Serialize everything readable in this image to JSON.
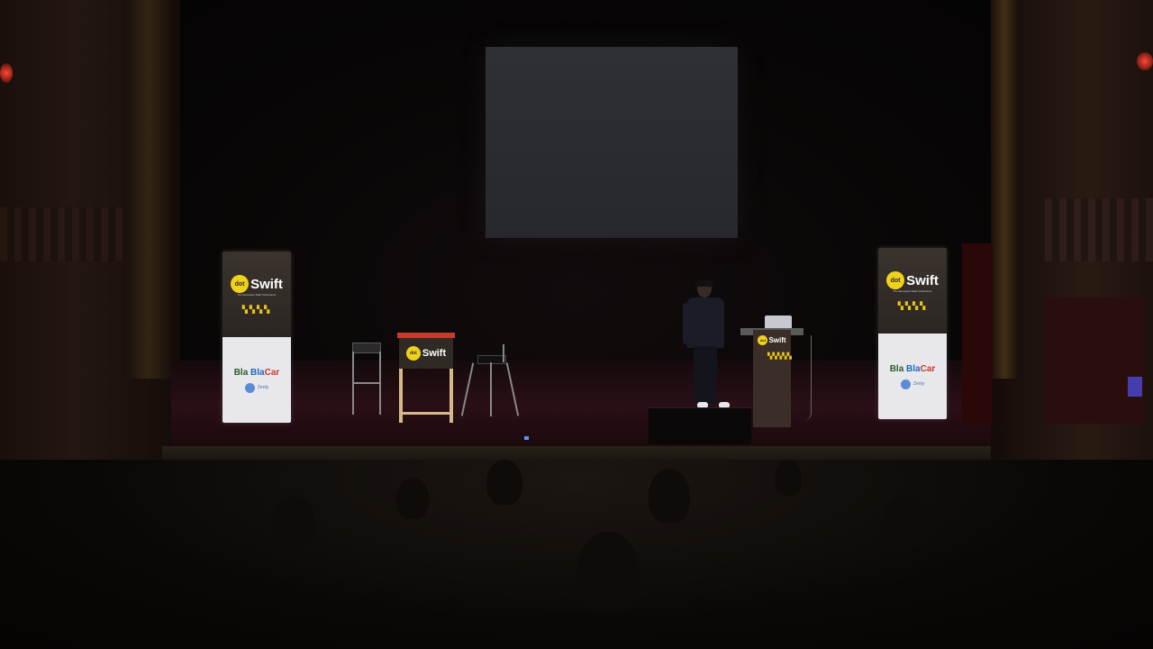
{
  "scene": {
    "description_free": true,
    "colors": {
      "banner_top": "#2c2622",
      "banner_bottom": "#e8e8ec",
      "brand_yellow": "#f0d21c",
      "screen": "#2a2c31",
      "stage": "#2a0f16"
    },
    "banner_left": {
      "brand_prefix": "dot",
      "brand_name": "Swift",
      "pattern": "▚▚▚▚",
      "tagline": "The European Swift Conference",
      "sponsor1_a": "Bla",
      "sponsor1_b": "Bla",
      "sponsor1_c": "Car",
      "sponsor2": "Zenly"
    },
    "banner_right": {
      "brand_prefix": "dot",
      "brand_name": "Swift",
      "pattern": "▚▚▚▚",
      "tagline": "The European Swift Conference",
      "sponsor1_a": "Bla",
      "sponsor1_b": "Bla",
      "sponsor1_c": "Car",
      "sponsor2": "Zenly"
    },
    "table": {
      "brand_prefix": "dot",
      "brand_name": "Swift",
      "pattern": "▚▚▚▚"
    },
    "podium": {
      "brand_prefix": "dot",
      "brand_name": "Swift",
      "pattern": "▚▚▚▚▚"
    }
  }
}
